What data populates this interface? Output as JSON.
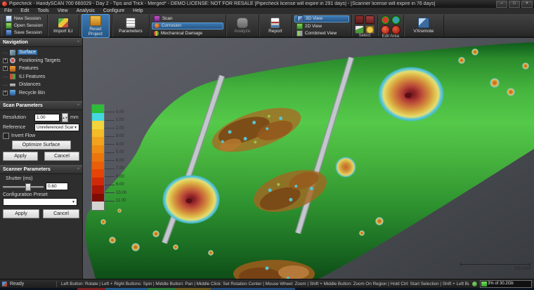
{
  "window": {
    "title": "Pipecheck - HandySCAN 700 660029 - Day 2 - Tips and Trick - Merged* - DEMO LICENSE: NOT FOR RESALE [Pipecheck license will expire in 291 days] - [Scanner license will expire in 76 days]",
    "controls": {
      "minimize": "–",
      "maximize": "□",
      "close": "×"
    }
  },
  "menu": {
    "items": [
      "File",
      "Edit",
      "Tools",
      "View",
      "Analysis",
      "Configure",
      "Help"
    ]
  },
  "toolbar": {
    "session": {
      "new": "New Session",
      "open": "Open Session",
      "save": "Save Session"
    },
    "import_ili": "Import ILI",
    "reset_project": "Reset Project",
    "parameters": "Parameters",
    "modes": {
      "scan": "Scan",
      "corrosion": "Corrosion",
      "mechanical_damage": "Mechanical Damage"
    },
    "analyze": "Analyze",
    "report": "Report",
    "views": {
      "view3d": "3D View",
      "view2d": "2D View",
      "combined": "Combined View"
    },
    "select_group": "Select",
    "edit_area_group": "Edit Area",
    "vxremote": "VXremote"
  },
  "sidebar": {
    "navigation": {
      "title": "Navigation",
      "items": [
        {
          "label": "Surface"
        },
        {
          "label": "Positioning Targets"
        },
        {
          "label": "Features"
        },
        {
          "label": "ILI Features"
        },
        {
          "label": "Distances"
        },
        {
          "label": "Recycle Bin"
        }
      ]
    },
    "scan_parameters": {
      "title": "Scan Parameters",
      "resolution_label": "Resolution",
      "resolution_value": "1.00",
      "resolution_unit": "mm",
      "reference_label": "Reference",
      "reference_value": "Unreferenced Scan",
      "invert_flow_label": "Invert Flow",
      "optimize_button": "Optimize Surface",
      "apply_button": "Apply",
      "cancel_button": "Cancel"
    },
    "scanner_parameters": {
      "title": "Scanner Parameters",
      "shutter_label": "Shutter (ms)",
      "shutter_value": "0.60",
      "preset_label": "Configuration Preset",
      "apply_button": "Apply",
      "cancel_button": "Cancel"
    }
  },
  "viewport": {
    "legend": {
      "colors": [
        "#2ebd38",
        "#45d8e0",
        "#f2d53c",
        "#f4bc26",
        "#f2a31c",
        "#ef8c12",
        "#ec760c",
        "#e95f08",
        "#e64306",
        "#d02a08",
        "#ab1607",
        "#7f0c05",
        "#d4d4d0"
      ],
      "labels": [
        "0.00",
        "1.00",
        "2.00",
        "3.00",
        "4.00",
        "5.00",
        "6.00",
        "7.00",
        "8.00",
        "9.00",
        "10.00",
        "11.00"
      ]
    },
    "scale_bar": {
      "label": "100 mm"
    }
  },
  "statusbar": {
    "ready": "Ready",
    "instructions": "Left Button: Rotate | Left + Right Buttons: Spin | Middle Button: Pan | Middle Click: Set Rotation Center | Mouse Wheel: Zoom | Shift + Middle Button: Zoom On Region | Hold Ctrl: Start Selection | Shift + Left Button: Measure",
    "memory": "3% of 30.2Gb"
  }
}
